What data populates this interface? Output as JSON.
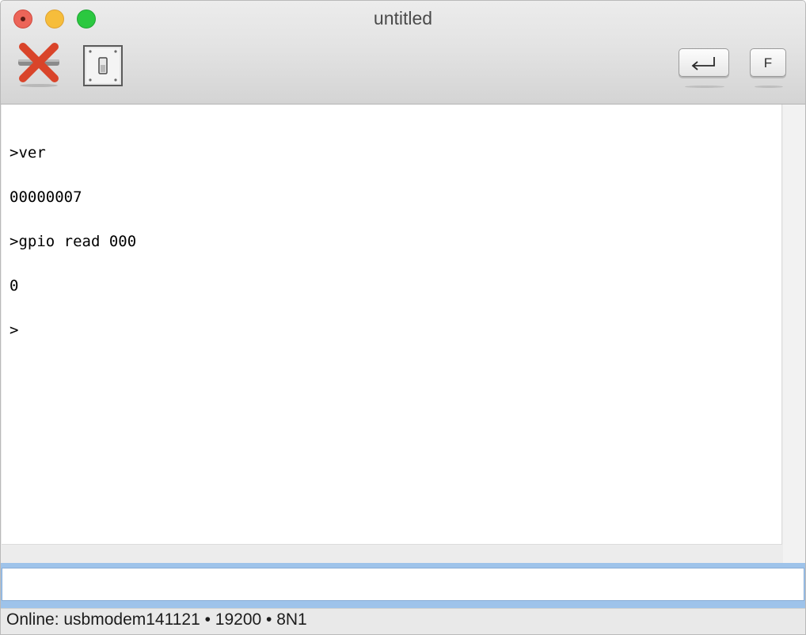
{
  "window": {
    "title": "untitled"
  },
  "toolbar": {
    "disconnect_icon": "red-x-disconnect-icon",
    "switch_icon": "toggle-switch-icon",
    "enter_icon": "return-key-icon",
    "f_key_label": "F"
  },
  "terminal": {
    "lines": [
      ">ver",
      "00000007",
      ">gpio read 000",
      "0",
      ">"
    ]
  },
  "input": {
    "value": ""
  },
  "status": {
    "text": "Online: usbmodem141121 • 19200 • 8N1"
  },
  "colors": {
    "disconnect_red": "#d9442a",
    "input_focus_ring": "#9ec3ea",
    "close_button": "#ec6559",
    "minimize_button": "#f6bd3b",
    "zoom_button": "#2bc840"
  }
}
